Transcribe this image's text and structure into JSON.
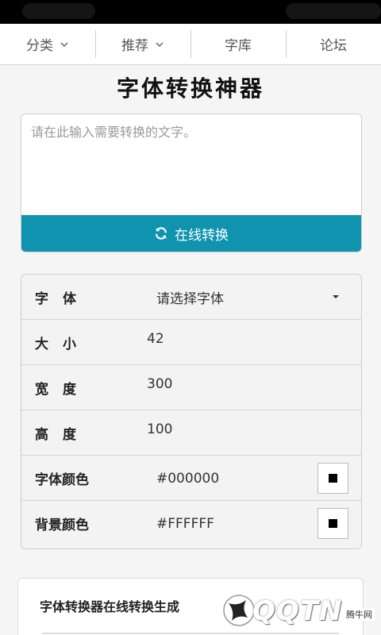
{
  "nav": {
    "items": [
      {
        "label": "分类",
        "has_dropdown": true
      },
      {
        "label": "推荐",
        "has_dropdown": true
      },
      {
        "label": "字库",
        "has_dropdown": false
      },
      {
        "label": "论坛",
        "has_dropdown": false
      }
    ]
  },
  "page": {
    "title": "字体转换神器"
  },
  "input": {
    "placeholder": "请在此输入需要转换的文字。",
    "value": ""
  },
  "convert_button": {
    "label": "在线转换",
    "icon": "refresh-icon",
    "color": "#0f93ae"
  },
  "settings": {
    "font": {
      "label": "字体",
      "value": "请选择字体"
    },
    "size": {
      "label": "大小",
      "value": "42"
    },
    "width": {
      "label": "宽度",
      "value": "300"
    },
    "height": {
      "label": "高度",
      "value": "100"
    },
    "font_color": {
      "label": "字体颜色",
      "value": "#000000"
    },
    "bg_color": {
      "label": "背景颜色",
      "value": "#FFFFFF"
    }
  },
  "info": {
    "text": "字体转换器在线转换生成"
  },
  "watermark": {
    "brand": "QQTN",
    "tag": "腾牛网"
  }
}
